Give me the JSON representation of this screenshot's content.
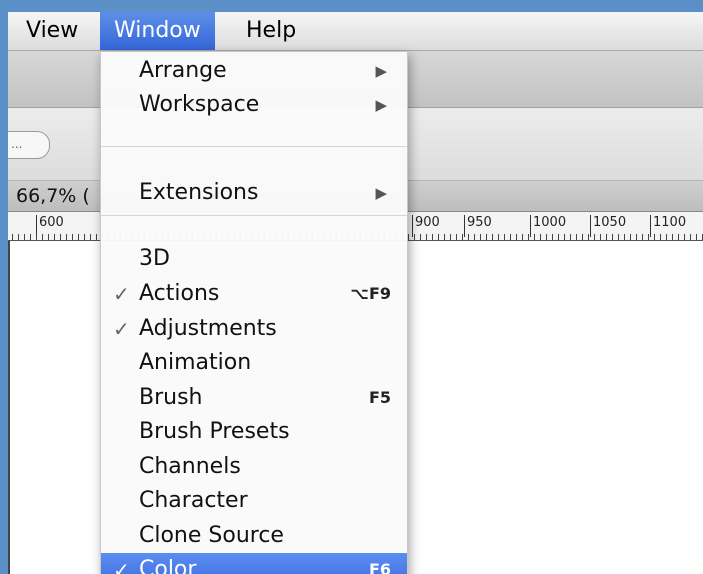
{
  "menubar": {
    "view": "View",
    "window": "Window",
    "help": "Help"
  },
  "toolbar": {
    "pill_text": "..."
  },
  "document": {
    "zoom_label": "66,7% ("
  },
  "ruler": {
    "labels": [
      "600",
      "900",
      "950",
      "1000",
      "1050",
      "1100"
    ]
  },
  "window_menu": {
    "items": [
      {
        "label": "Arrange",
        "submenu": true
      },
      {
        "label": "Workspace",
        "submenu": true
      },
      {
        "label": "Extensions",
        "submenu": true
      },
      {
        "label": "3D"
      },
      {
        "label": "Actions",
        "checked": true,
        "shortcut": "⌥F9"
      },
      {
        "label": "Adjustments",
        "checked": true
      },
      {
        "label": "Animation"
      },
      {
        "label": "Brush",
        "shortcut": "F5"
      },
      {
        "label": "Brush Presets"
      },
      {
        "label": "Channels"
      },
      {
        "label": "Character"
      },
      {
        "label": "Clone Source"
      },
      {
        "label": "Color",
        "checked": true,
        "shortcut": "F6",
        "highlighted": true
      }
    ],
    "check_glyph": "✓",
    "submenu_glyph": "▶"
  },
  "colors": {
    "highlight": "#3b6ce0",
    "menubar_active": "#3466d9",
    "desktop": "#5b8fc7"
  }
}
